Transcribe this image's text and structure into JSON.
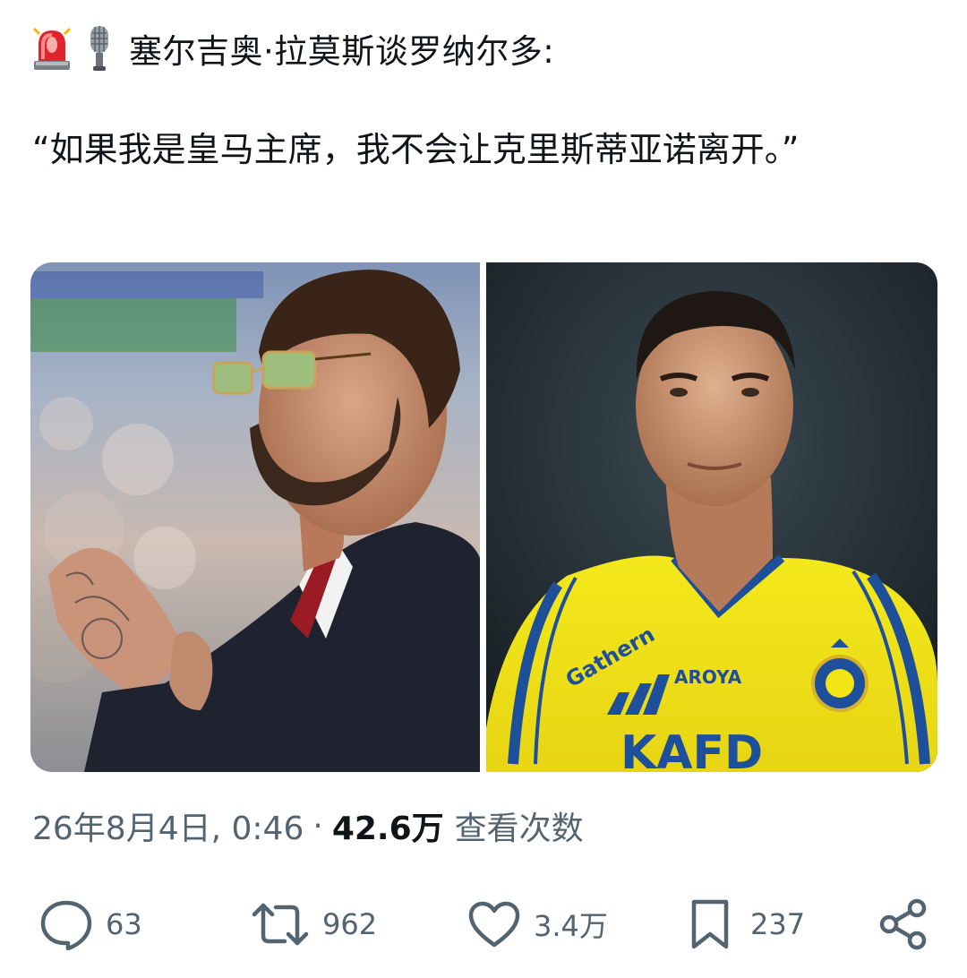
{
  "post": {
    "header_text": "塞尔吉奥·拉莫斯谈罗纳尔多:",
    "header_icons": [
      "siren-icon",
      "microphone-icon"
    ],
    "quote": "“如果我是皇马主席，我不会让克里斯蒂亚诺离开。”",
    "images": [
      {
        "name": "photo-sergio-ramos",
        "description_color": "#2a2f3a"
      },
      {
        "name": "photo-cristiano-ronaldo",
        "jersey_text": [
          "Gathern",
          "AROYA",
          "KAFD"
        ],
        "jersey_color": "#f2e516"
      }
    ],
    "timestamp": "26年8月4日, 0:46",
    "separator": "·",
    "views_count": "42.6万",
    "views_label": "查看次数"
  },
  "actions": {
    "reply": {
      "icon": "reply-icon",
      "count": "63"
    },
    "retweet": {
      "icon": "retweet-icon",
      "count": "962"
    },
    "like": {
      "icon": "heart-icon",
      "count": "3.4万"
    },
    "bookmark": {
      "icon": "bookmark-icon",
      "count": "237"
    },
    "share": {
      "icon": "share-icon"
    }
  },
  "colors": {
    "text_primary": "#0f1419",
    "text_secondary": "#536471",
    "siren_red": "#e0242b",
    "jersey_yellow": "#f2e516",
    "jersey_blue": "#1d4f9a"
  }
}
